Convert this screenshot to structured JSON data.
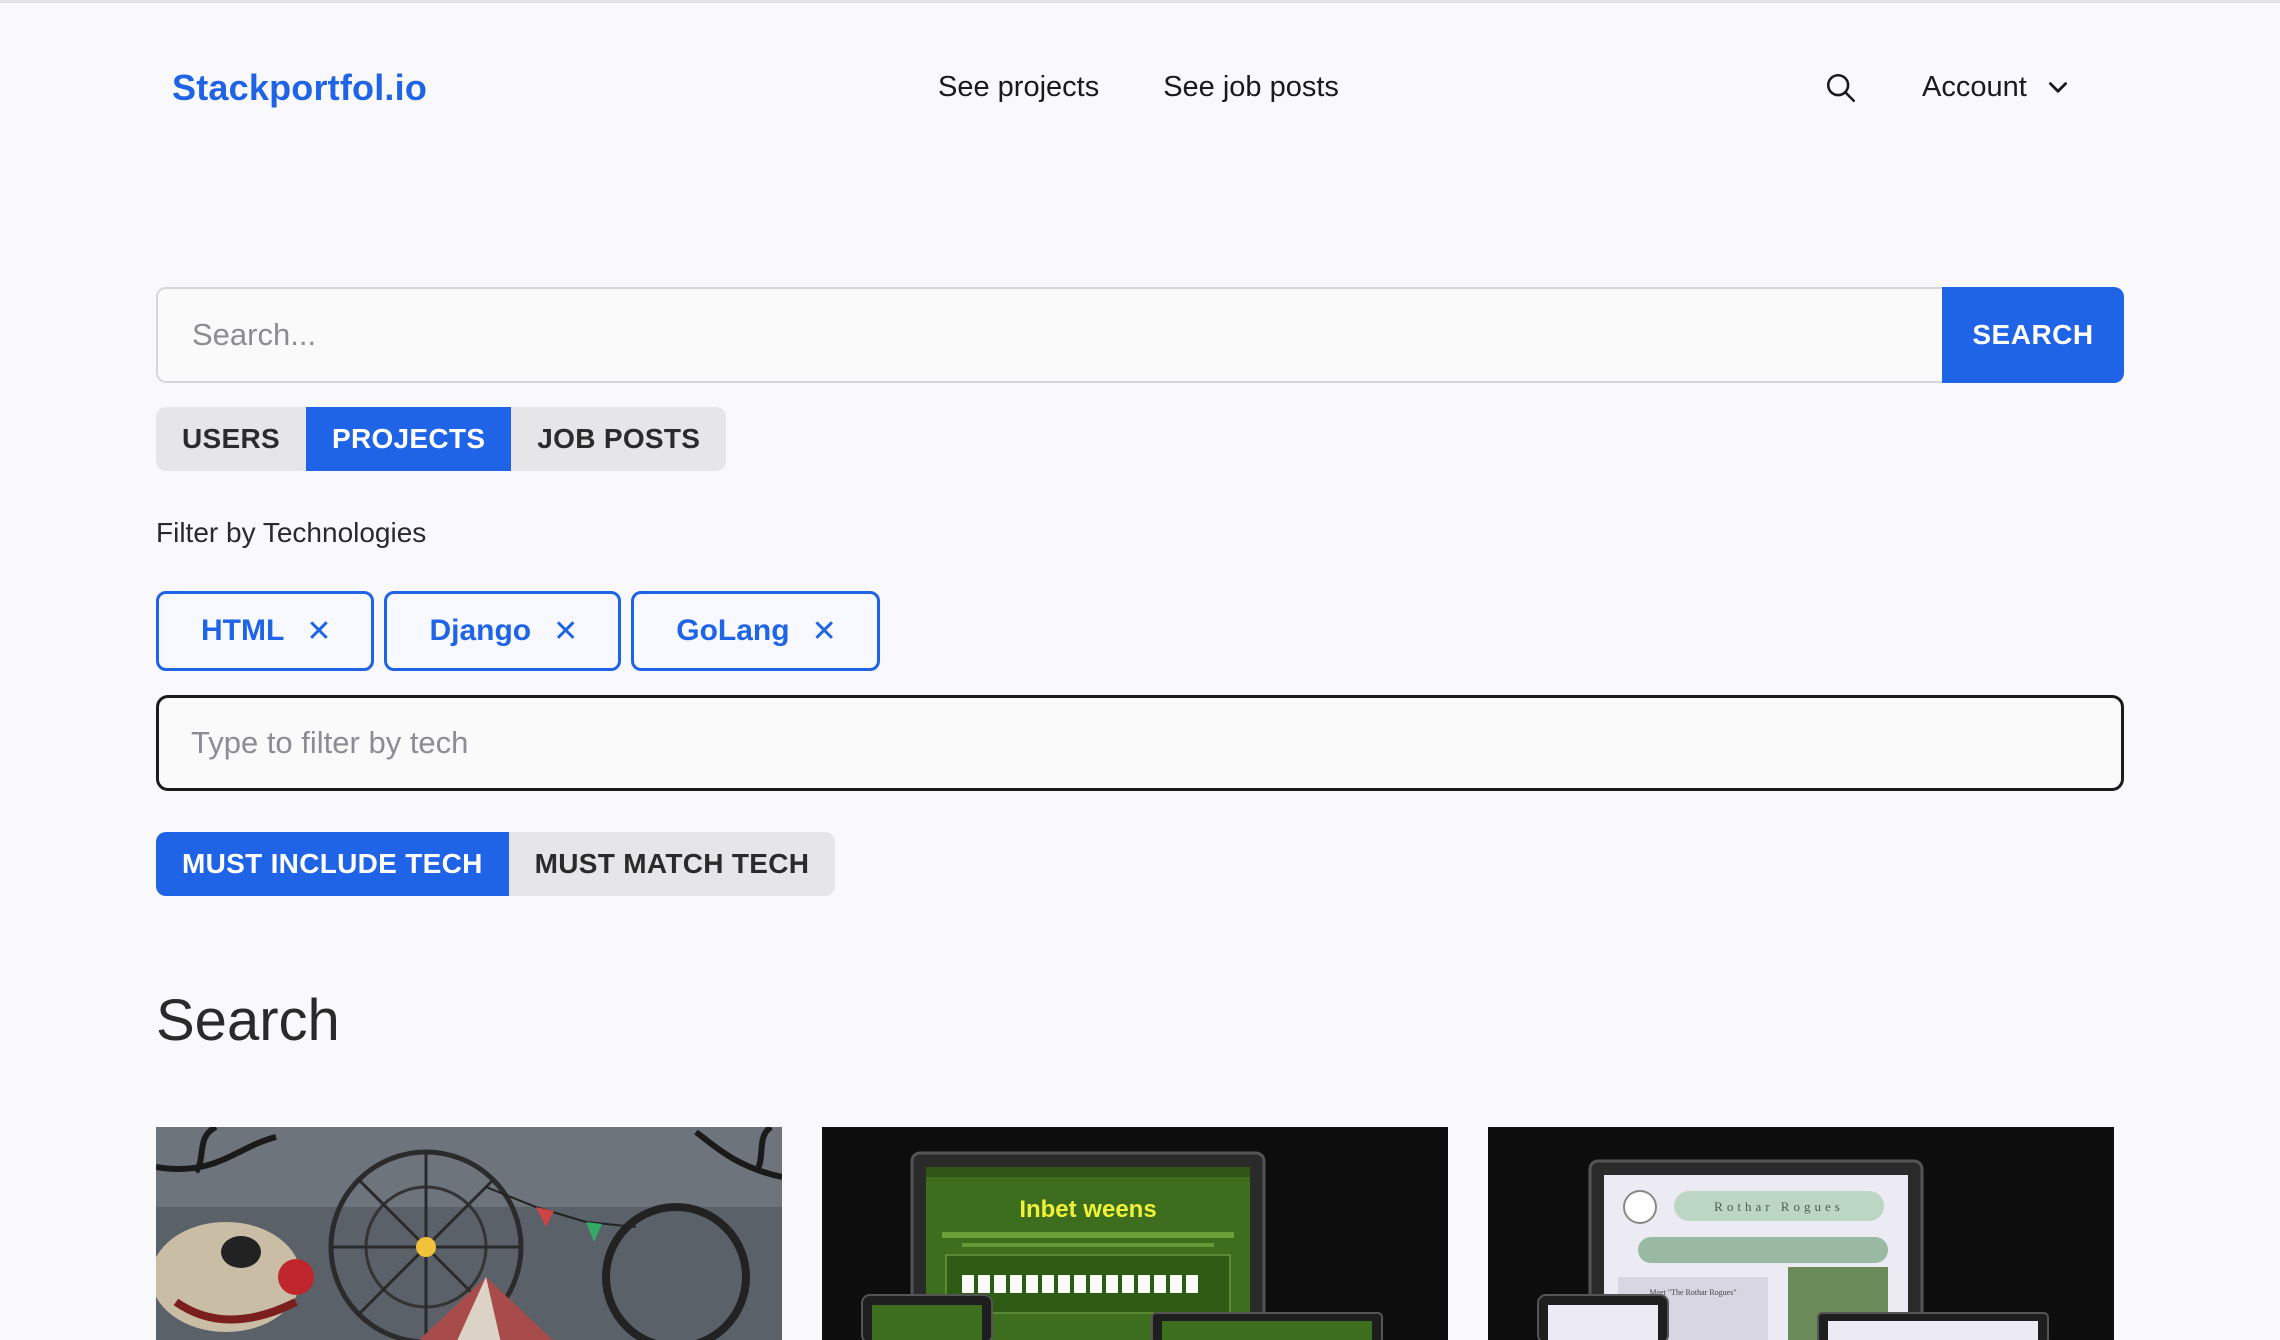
{
  "header": {
    "logo": "Stackportfol.io",
    "nav": [
      "See projects",
      "See job posts"
    ],
    "account_label": "Account"
  },
  "search": {
    "placeholder": "Search...",
    "button_label": "SEARCH"
  },
  "type_tabs": {
    "options": [
      "USERS",
      "PROJECTS",
      "JOB POSTS"
    ],
    "selected": "PROJECTS"
  },
  "filter": {
    "label": "Filter by Technologies",
    "chips": [
      "HTML",
      "Django",
      "GoLang"
    ],
    "input_placeholder": "Type to filter by tech"
  },
  "match_tabs": {
    "options": [
      "MUST INCLUDE TECH",
      "MUST MATCH TECH"
    ],
    "selected": "MUST INCLUDE TECH"
  },
  "results": {
    "title": "Search",
    "cards": [
      {
        "thumbnail_text": ""
      },
      {
        "thumbnail_text": "Inbet weens"
      },
      {
        "thumbnail_text": "Rothar Rogues",
        "thumbnail_subtext": "Meet \"The Rothar Rogues\""
      }
    ]
  },
  "colors": {
    "accent": "#1f63e6",
    "background": "#f9f9fb"
  }
}
